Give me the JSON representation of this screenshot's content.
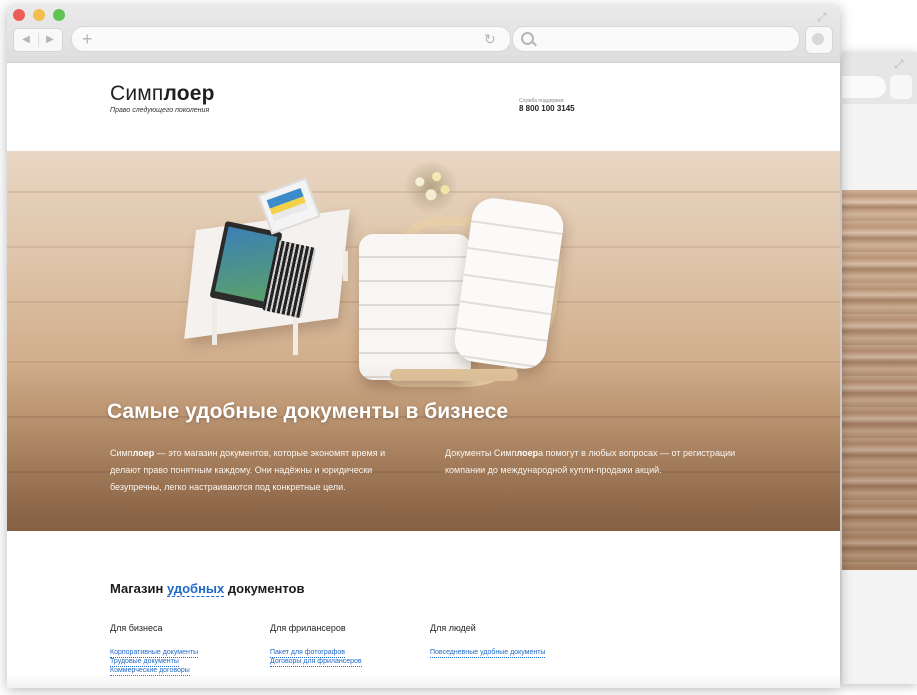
{
  "back_window": {},
  "browser": {
    "nav_back": "◀",
    "nav_forward": "▶",
    "new_tab": "+",
    "reload": "↻",
    "url": "",
    "search_placeholder": ""
  },
  "header": {
    "logo_regular": "Симп",
    "logo_bold": "лоер",
    "tagline": "Право следующего поколения",
    "support_label": "Служба поддержки",
    "support_phone": "8 800 100 3145"
  },
  "hero": {
    "title": "Самые удобные документы в бизнесе",
    "left_brand_regular": "Симп",
    "left_brand_bold": "лоер",
    "left_text": " — это магазин документов, которые экономят время и делают право понятным каждому. Они надёжны и юридически безупречны, легко настраиваются под конкретные цели.",
    "right_prefix": "Документы Симп",
    "right_brand_bold": "лоер",
    "right_text": "а помогут в любых вопросах — от регистрации компании до международной купли-продажи акций."
  },
  "shop": {
    "title_before": "Магазин ",
    "title_accent": "удобных",
    "title_after": " документов",
    "columns": [
      {
        "heading": "Для бизнеса",
        "links": [
          "Корпоративные документы",
          "Трудовые документы",
          "Коммерческие договоры"
        ]
      },
      {
        "heading": "Для фрилансеров",
        "links": [
          "Пакет для фотографов",
          "Договоры для фрилансеров"
        ]
      },
      {
        "heading": "Для людей",
        "links": [
          "Повседневные удобные документы"
        ]
      }
    ]
  },
  "colors": {
    "accent": "#1f69c9",
    "close": "#ee5c56",
    "minimize": "#f4bd4f",
    "maximize": "#5fc453"
  }
}
